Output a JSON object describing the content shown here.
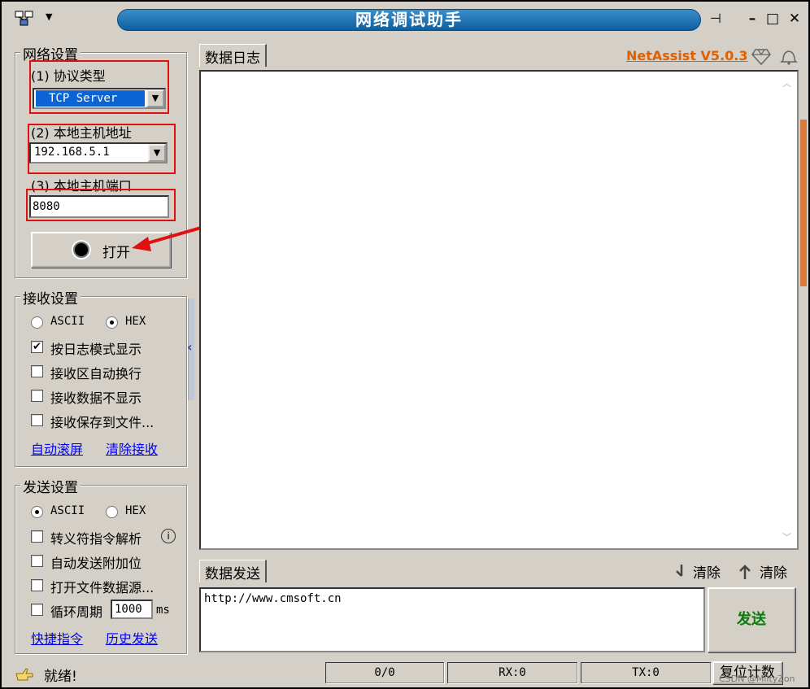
{
  "window": {
    "title": "网络调试助手",
    "pin_glyph": "⊣",
    "min_glyph": "–",
    "max_glyph": "□",
    "close_glyph": "✕",
    "menu_glyph": "▼"
  },
  "net": {
    "group_title": "网络设置",
    "proto_label": "(1) 协议类型",
    "proto_value": "TCP Server",
    "host_label": "(2) 本地主机地址",
    "host_value": "192.168.5.1",
    "port_label": "(3) 本地主机端口",
    "port_value": "8080",
    "open_label": "打开",
    "dropdown_glyph": "▼"
  },
  "recv": {
    "group_title": "接收设置",
    "ascii": "ASCII",
    "hex": "HEX",
    "encoding_selected": "HEX",
    "opt1": "按日志模式显示",
    "opt1_checked": "✔",
    "opt2": "接收区自动换行",
    "opt3": "接收数据不显示",
    "opt4": "接收保存到文件...",
    "link_autoscroll": "自动滚屏",
    "link_clear": "清除接收"
  },
  "send": {
    "group_title": "发送设置",
    "ascii": "ASCII",
    "hex": "HEX",
    "encoding_selected": "ASCII",
    "opt1": "转义符指令解析",
    "info_glyph": "i",
    "opt2": "自动发送附加位",
    "opt3": "打开文件数据源...",
    "opt4": "循环周期",
    "period_value": "1000",
    "period_unit": "ms",
    "link_shortcut": "快捷指令",
    "link_history": "历史发送"
  },
  "log": {
    "tab_label": "数据日志",
    "version_link": "NetAssist V5.0.3"
  },
  "sendpanel": {
    "tab_label": "数据发送",
    "clear1": "清除",
    "clear2": "清除",
    "text": "http://www.cmsoft.cn",
    "send_button": "发送"
  },
  "status": {
    "text": "就绪!",
    "count": "0/0",
    "rx": "RX:0",
    "tx": "TX:0",
    "reset": "复位计数",
    "watermark": "CSDN @MiltyZon"
  },
  "colors": {
    "title_bg": "#0d5fa0",
    "highlight_box": "#e01010",
    "link": "#0000ee",
    "version": "#e06000",
    "send_text": "#0a7a0a"
  }
}
